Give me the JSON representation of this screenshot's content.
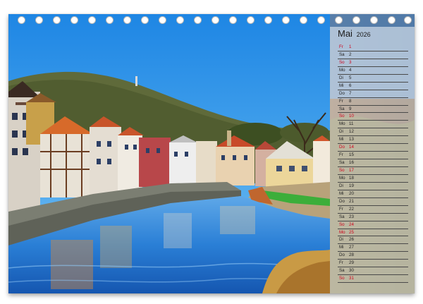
{
  "calendar": {
    "month": "Mai",
    "year": "2026",
    "days": [
      {
        "dow": "Fr",
        "day": "1",
        "holiday": true
      },
      {
        "dow": "Sa",
        "day": "2",
        "holiday": false
      },
      {
        "dow": "So",
        "day": "3",
        "holiday": true
      },
      {
        "dow": "Mo",
        "day": "4",
        "holiday": false
      },
      {
        "dow": "Di",
        "day": "5",
        "holiday": false
      },
      {
        "dow": "Mi",
        "day": "6",
        "holiday": false
      },
      {
        "dow": "Do",
        "day": "7",
        "holiday": false
      },
      {
        "dow": "Fr",
        "day": "8",
        "holiday": false
      },
      {
        "dow": "Sa",
        "day": "9",
        "holiday": false
      },
      {
        "dow": "So",
        "day": "10",
        "holiday": true
      },
      {
        "dow": "Mo",
        "day": "11",
        "holiday": false
      },
      {
        "dow": "Di",
        "day": "12",
        "holiday": false
      },
      {
        "dow": "Mi",
        "day": "13",
        "holiday": false
      },
      {
        "dow": "Do",
        "day": "14",
        "holiday": true
      },
      {
        "dow": "Fr",
        "day": "15",
        "holiday": false
      },
      {
        "dow": "Sa",
        "day": "16",
        "holiday": false
      },
      {
        "dow": "So",
        "day": "17",
        "holiday": true
      },
      {
        "dow": "Mo",
        "day": "18",
        "holiday": false
      },
      {
        "dow": "Di",
        "day": "19",
        "holiday": false
      },
      {
        "dow": "Mi",
        "day": "20",
        "holiday": false
      },
      {
        "dow": "Do",
        "day": "21",
        "holiday": false
      },
      {
        "dow": "Fr",
        "day": "22",
        "holiday": false
      },
      {
        "dow": "Sa",
        "day": "23",
        "holiday": false
      },
      {
        "dow": "So",
        "day": "24",
        "holiday": true
      },
      {
        "dow": "Mo",
        "day": "25",
        "holiday": true
      },
      {
        "dow": "Di",
        "day": "26",
        "holiday": false
      },
      {
        "dow": "Mi",
        "day": "27",
        "holiday": false
      },
      {
        "dow": "Do",
        "day": "28",
        "holiday": false
      },
      {
        "dow": "Fr",
        "day": "29",
        "holiday": false
      },
      {
        "dow": "Sa",
        "day": "30",
        "holiday": false
      },
      {
        "dow": "So",
        "day": "31",
        "holiday": true
      }
    ]
  },
  "colors": {
    "holiday": "#d0021b",
    "text": "#222222",
    "sky": "#2f93e6",
    "river": "#1f6fc8"
  }
}
